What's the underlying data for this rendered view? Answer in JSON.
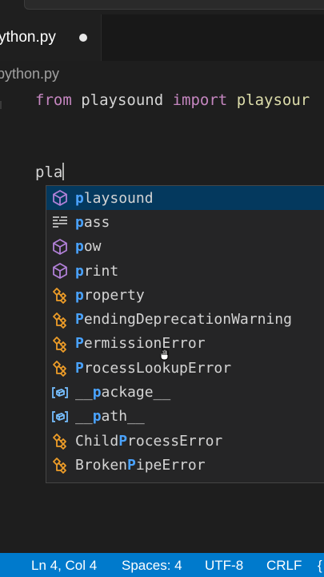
{
  "titlebar": {
    "search_text": "..., ..."
  },
  "tab": {
    "filename": "ython.py"
  },
  "breadcrumb": {
    "file": "python.py"
  },
  "editor": {
    "line1": {
      "kw1": "from",
      "mod": " playsound ",
      "kw2": "import",
      "fn": " playsour"
    },
    "line4": {
      "typed": "pla"
    }
  },
  "suggestions": [
    {
      "icon": "method-icon",
      "match": "p",
      "rest": "laysound",
      "pre": ""
    },
    {
      "icon": "keyword-icon",
      "match": "p",
      "rest": "ass",
      "pre": ""
    },
    {
      "icon": "method-icon",
      "match": "p",
      "rest": "ow",
      "pre": ""
    },
    {
      "icon": "method-icon",
      "match": "p",
      "rest": "rint",
      "pre": ""
    },
    {
      "icon": "class-icon",
      "match": "p",
      "rest": "roperty",
      "pre": ""
    },
    {
      "icon": "class-icon",
      "match": "P",
      "rest": "endingDeprecationWarning",
      "pre": ""
    },
    {
      "icon": "class-icon",
      "match": "P",
      "rest": "ermissionError",
      "pre": ""
    },
    {
      "icon": "class-icon",
      "match": "P",
      "rest": "rocessLookupError",
      "pre": ""
    },
    {
      "icon": "variable-icon",
      "match": "p",
      "rest": "ackage__",
      "pre": "__"
    },
    {
      "icon": "variable-icon",
      "match": "p",
      "rest": "ath__",
      "pre": "__"
    },
    {
      "icon": "class-icon",
      "match": "P",
      "rest": "rocessError",
      "pre": "Child"
    },
    {
      "icon": "class-icon",
      "match": "P",
      "rest": "ipeError",
      "pre": "Broken"
    }
  ],
  "statusbar": {
    "position": "Ln 4, Col 4",
    "spaces": "Spaces: 4",
    "encoding": "UTF-8",
    "eol": "CRLF",
    "lang_brace": "{"
  },
  "colors": {
    "accent": "#007acc",
    "match": "#4aa3ff",
    "selected": "#04395e",
    "class_icon": "#ee9d28",
    "method_icon": "#b180d7"
  }
}
